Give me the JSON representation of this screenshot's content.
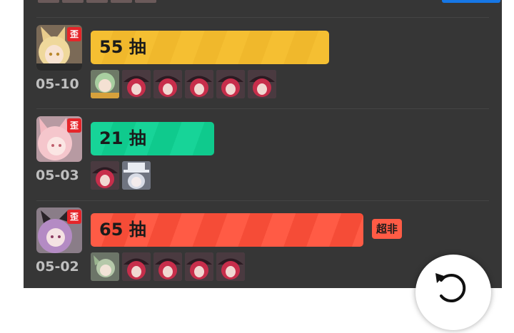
{
  "pulls": [
    {
      "date": "05-10",
      "count": "55",
      "unit": "抽",
      "badge": "歪",
      "color": "yellow",
      "icons": [
        "lime-haired-operator-icon",
        "crimson-hat-operator-icon",
        "crimson-hat-operator-icon",
        "crimson-hat-operator-icon",
        "crimson-hat-operator-icon",
        "crimson-hat-operator-icon"
      ]
    },
    {
      "date": "05-03",
      "count": "21",
      "unit": "抽",
      "badge": "歪",
      "color": "green",
      "icons": [
        "crimson-hat-operator-icon",
        "white-hat-operator-icon"
      ]
    },
    {
      "date": "05-02",
      "count": "65",
      "unit": "抽",
      "badge": "歪",
      "color": "red",
      "tag": "超非",
      "icons": [
        "green-haired-operator-icon",
        "crimson-hat-operator-icon",
        "crimson-hat-operator-icon",
        "crimson-hat-operator-icon",
        "crimson-hat-operator-icon"
      ]
    }
  ],
  "colors": {
    "panel": "#363636",
    "yellow": "#f5bf32",
    "green": "#17d498",
    "red": "#ff5b45",
    "badge": "#e5252a",
    "blue": "#1677e6"
  }
}
